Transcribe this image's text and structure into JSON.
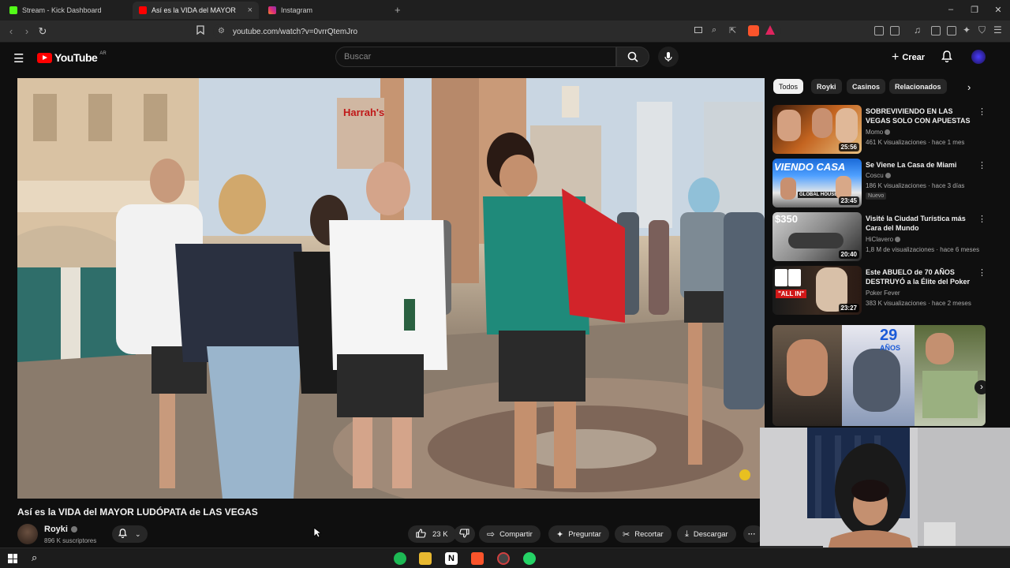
{
  "tabs": [
    {
      "label": "Stream - Kick Dashboard",
      "color": "#53fc18"
    },
    {
      "label": "Así es la VIDA del MAYOR LUDÓ",
      "color": "#ff0000"
    },
    {
      "label": "Instagram",
      "color": "#e1306c"
    }
  ],
  "new_tab": "+",
  "address": {
    "url": "youtube.com/watch?v=0vrrQtemJro"
  },
  "youtube": {
    "logo": "YouTube",
    "region": "AR",
    "search_placeholder": "Buscar",
    "create_label": "Crear"
  },
  "video": {
    "title": "Así es la VIDA del MAYOR LUDÓPATA de LAS VEGAS",
    "channel": "Royki",
    "subscribers": "896 K suscriptores",
    "likes": "23 K",
    "share": "Compartir",
    "ask": "Preguntar",
    "clip": "Recortar",
    "download": "Descargar",
    "sign_text": "Harrah's"
  },
  "chips": [
    "Todos",
    "Royki",
    "Casinos",
    "Relacionados"
  ],
  "recommendations": [
    {
      "title": "SOBREVIVIENDO EN LAS VEGAS SOLO CON APUESTAS",
      "channel": "Momo",
      "meta": "461 K visualizaciones · hace 1 mes",
      "duration": "25:56",
      "badge": ""
    },
    {
      "title": "Se Viene La Casa de Miami",
      "channel": "Coscu",
      "meta": "186 K visualizaciones · hace 3 días",
      "duration": "23:45",
      "badge": "Nuevo",
      "thumb_text": "VIENDO CASA",
      "thumb_sub": "GLOBAL HOUSE"
    },
    {
      "title": "Visité la Ciudad Turística más Cara del Mundo",
      "channel": "HiClavero",
      "meta": "1,8 M de visualizaciones · hace 6 meses",
      "duration": "20:40",
      "badge": "",
      "thumb_text": "$350"
    },
    {
      "title": "Este ABUELO de 70 AÑOS DESTRUYÓ a la Élite del Poker",
      "channel": "Poker Fever",
      "meta": "383 K visualizaciones · hace 2 meses",
      "duration": "23:27",
      "badge": "",
      "thumb_text": "\"ALL IN\""
    }
  ],
  "shorts_banner": {
    "number": "29",
    "word": "AÑOS"
  },
  "colors": {
    "accent_red": "#ff0000",
    "bg": "#0f0f0f",
    "chip": "#272727"
  }
}
